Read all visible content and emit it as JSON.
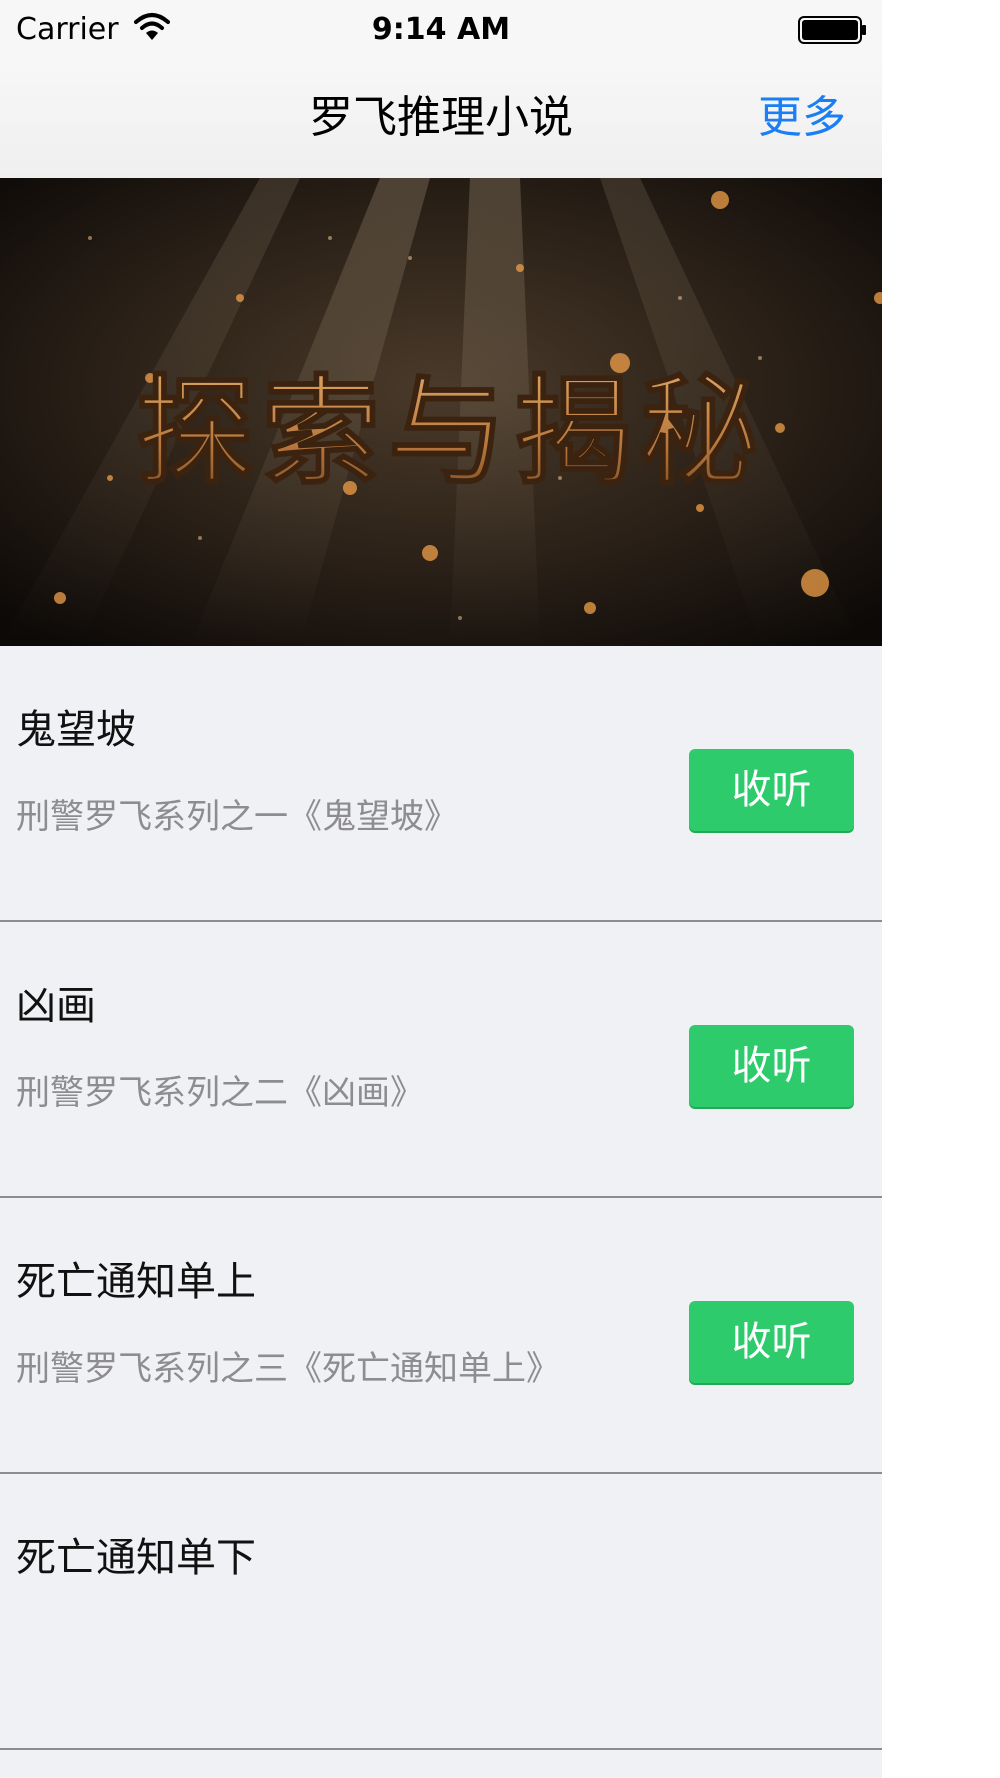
{
  "status_bar": {
    "carrier": "Carrier",
    "time": "9:14 AM",
    "wifi_icon": "wifi-icon",
    "battery_icon": "battery-icon"
  },
  "nav": {
    "title": "罗飞推理小说",
    "more_label": "更多"
  },
  "banner": {
    "text": "探索与揭秘",
    "text_color": "#c98a4a",
    "background_color": "#2a2017"
  },
  "list": [
    {
      "title": "鬼望坡",
      "subtitle": "刑警罗飞系列之一《鬼望坡》",
      "button": "收听"
    },
    {
      "title": "凶画",
      "subtitle": "刑警罗飞系列之二《凶画》",
      "button": "收听"
    },
    {
      "title": "死亡通知单上",
      "subtitle": "刑警罗飞系列之三《死亡通知单上》",
      "button": "收听"
    },
    {
      "title": "死亡通知单下"
    }
  ],
  "colors": {
    "accent_blue": "#1a7ff4",
    "button_green": "#2ecb6c",
    "list_background": "#f0f1f4",
    "subtitle_gray": "#8d8d8f"
  }
}
